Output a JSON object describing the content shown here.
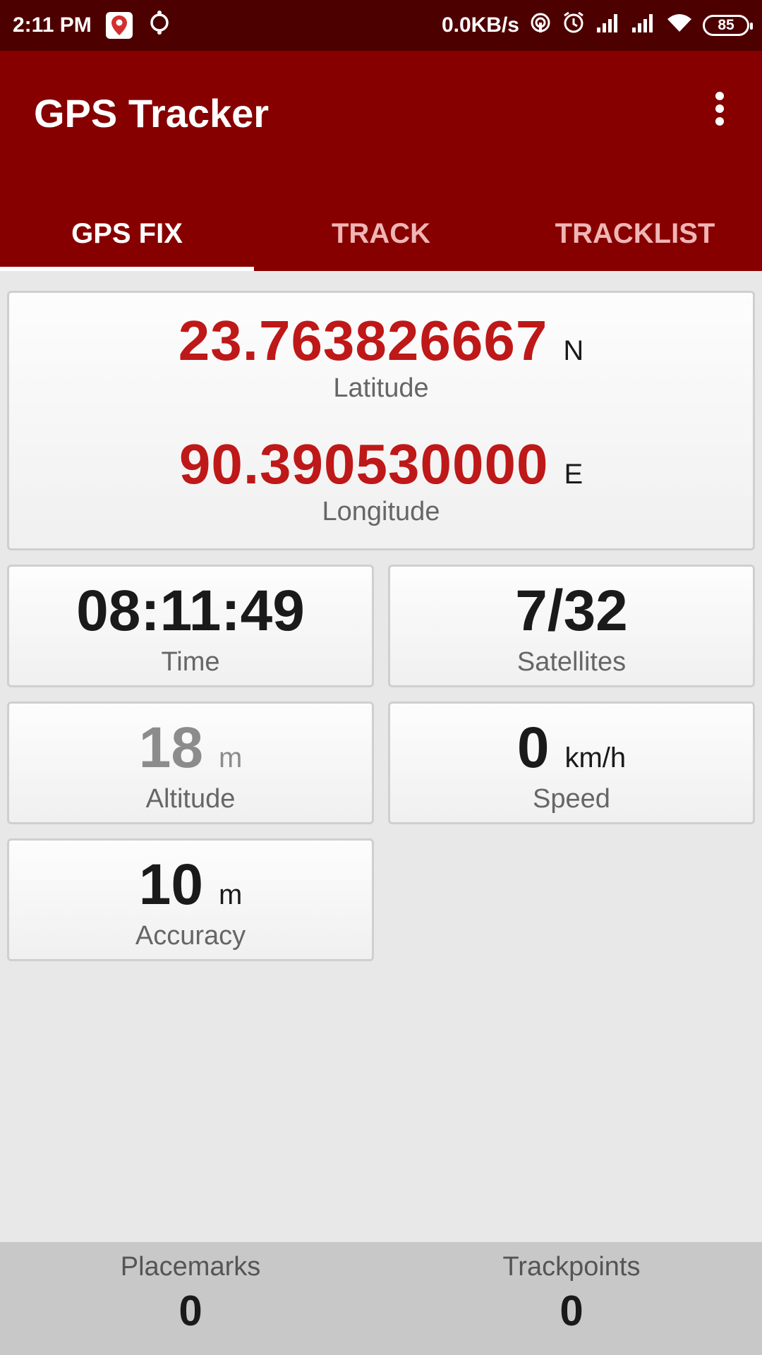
{
  "status_bar": {
    "time": "2:11 PM",
    "net_speed": "0.0KB/s",
    "battery": "85"
  },
  "app_bar": {
    "title": "GPS Tracker"
  },
  "tabs": [
    {
      "label": "GPS FIX",
      "active": true
    },
    {
      "label": "TRACK",
      "active": false
    },
    {
      "label": "TRACKLIST",
      "active": false
    }
  ],
  "gps": {
    "latitude": {
      "value": "23.763826667",
      "unit": "N",
      "label": "Latitude"
    },
    "longitude": {
      "value": "90.390530000",
      "unit": "E",
      "label": "Longitude"
    },
    "time": {
      "value": "08:11:49",
      "label": "Time"
    },
    "satellites": {
      "value": "7/32",
      "label": "Satellites"
    },
    "altitude": {
      "value": "18",
      "unit": "m",
      "label": "Altitude"
    },
    "speed": {
      "value": "0",
      "unit": "km/h",
      "label": "Speed"
    },
    "accuracy": {
      "value": "10",
      "unit": "m",
      "label": "Accuracy"
    }
  },
  "bottom": {
    "placemarks": {
      "label": "Placemarks",
      "value": "0"
    },
    "trackpoints": {
      "label": "Trackpoints",
      "value": "0"
    }
  },
  "colors": {
    "app_bar": "#870000",
    "status_bar": "#4d0000",
    "coordinate": "#be1818"
  },
  "icons": [
    "maps-pin-icon",
    "sync-icon",
    "hotspot-icon",
    "alarm-icon",
    "signal-icon",
    "wifi-icon",
    "battery-icon",
    "overflow-menu-icon"
  ]
}
